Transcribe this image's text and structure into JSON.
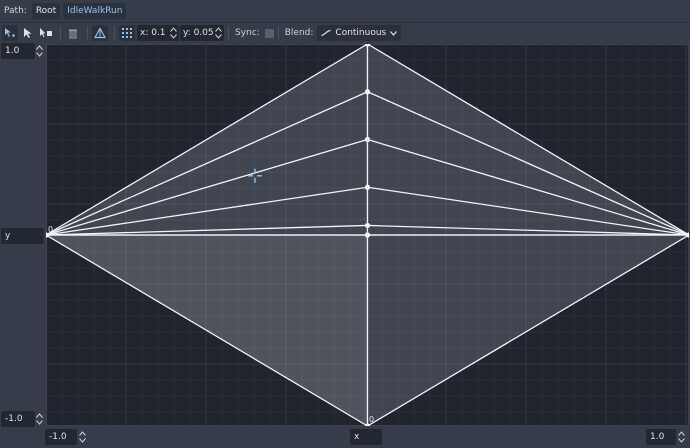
{
  "path": {
    "label": "Path:",
    "crumbs": [
      "Root",
      "IdleWalkRun"
    ]
  },
  "toolbar": {
    "snap_x": "x: 0.1",
    "snap_y": "y: 0.05",
    "sync_label": "Sync:",
    "blend_label": "Blend:",
    "blend_value": "Continuous"
  },
  "axes": {
    "max_y": "1.0",
    "min_y": "-1.0",
    "y_label": "y",
    "min_x": "-1.0",
    "x_label": "x",
    "max_x": "1.0",
    "origin_left": "0",
    "origin_bottom": "0"
  },
  "colors": {
    "accent": "#8fc3f2",
    "canvas_bg": "#1f242d",
    "panel_bg": "#363d4a"
  },
  "blend_points": [
    {
      "x": -1.0,
      "y": 0.0
    },
    {
      "x": 1.0,
      "y": 0.0
    },
    {
      "x": 0.0,
      "y": 1.0
    },
    {
      "x": 0.0,
      "y": -1.0
    },
    {
      "x": 0.0,
      "y": 0.75
    },
    {
      "x": 0.0,
      "y": 0.5
    },
    {
      "x": 0.0,
      "y": 0.25
    },
    {
      "x": 0.0,
      "y": 0.05
    },
    {
      "x": 0.0,
      "y": 0.0
    }
  ],
  "blend_cursor": {
    "x": -0.35,
    "y": 0.31
  }
}
